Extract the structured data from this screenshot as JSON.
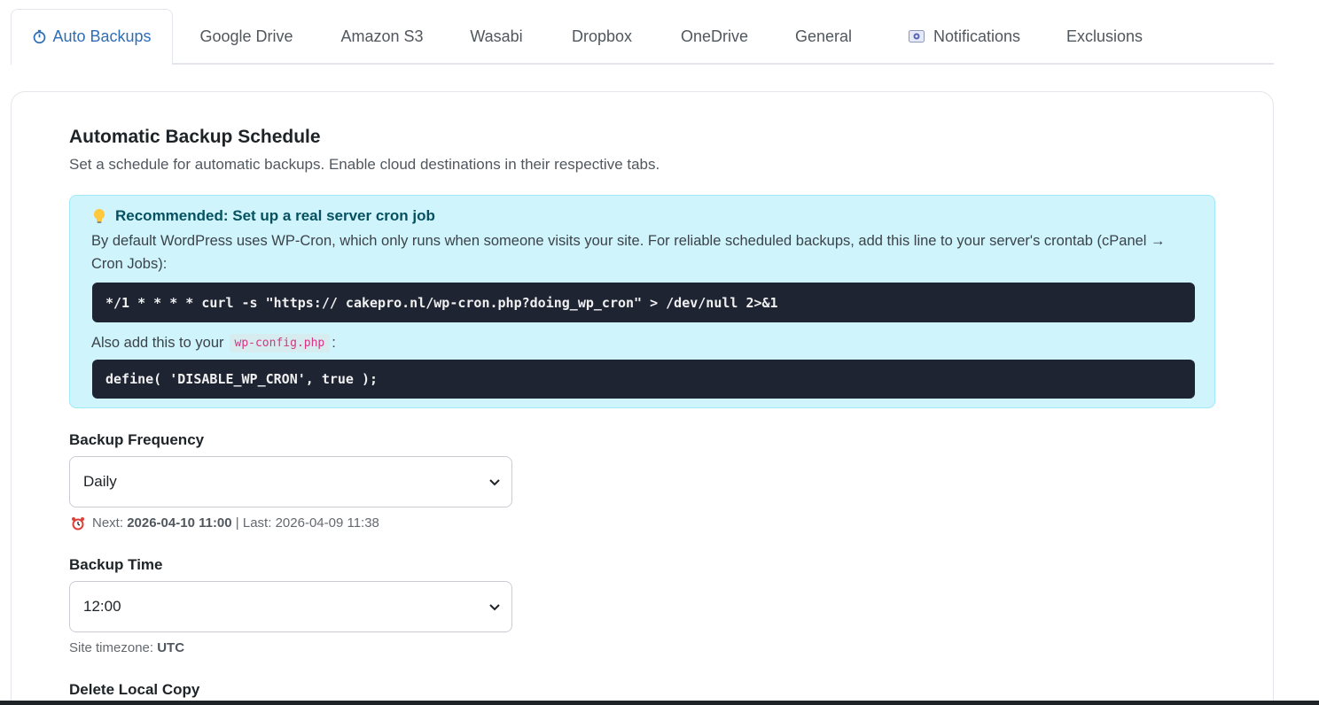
{
  "tabs": [
    {
      "label": "Auto Backups",
      "icon": "stopwatch-icon",
      "active": true
    },
    {
      "label": "Google Drive"
    },
    {
      "label": "Amazon S3"
    },
    {
      "label": "Wasabi"
    },
    {
      "label": "Dropbox"
    },
    {
      "label": "OneDrive"
    },
    {
      "label": "General"
    },
    {
      "label": "Notifications",
      "icon": "email-icon"
    },
    {
      "label": "Exclusions"
    }
  ],
  "schedule": {
    "title": "Automatic Backup Schedule",
    "description": "Set a schedule for automatic backups. Enable cloud destinations in their respective tabs."
  },
  "notice": {
    "title": "Recommended: Set up a real server cron job",
    "text": "By default WordPress uses WP-Cron, which only runs when someone visits your site. For reliable scheduled backups, add this line to your server's crontab (cPanel → Cron Jobs):",
    "cron_command": "*/1 * * * * curl -s \"https:// cakepro.nl/wp-cron.php?doing_wp_cron\" > /dev/null 2>&1",
    "also_text": "Also add this to your",
    "config_file": "wp-config.php",
    "colon": ":",
    "define_line": "define( 'DISABLE_WP_CRON', true );"
  },
  "frequency": {
    "label": "Backup Frequency",
    "value": "Daily",
    "next_label": "Next:",
    "next_value": "2026-04-10 11:00",
    "separator": "|",
    "last_label": "Last:",
    "last_value": "2026-04-09 11:38"
  },
  "time": {
    "label": "Backup Time",
    "value": "12:00",
    "tz_label": "Site timezone:",
    "tz_value": "UTC"
  },
  "delete_local": {
    "label": "Delete Local Copy"
  },
  "colors": {
    "accent": "#2f6db5",
    "notice_bg": "#cff4fc",
    "notice_title": "#055160",
    "code_bg": "#1e2432"
  }
}
